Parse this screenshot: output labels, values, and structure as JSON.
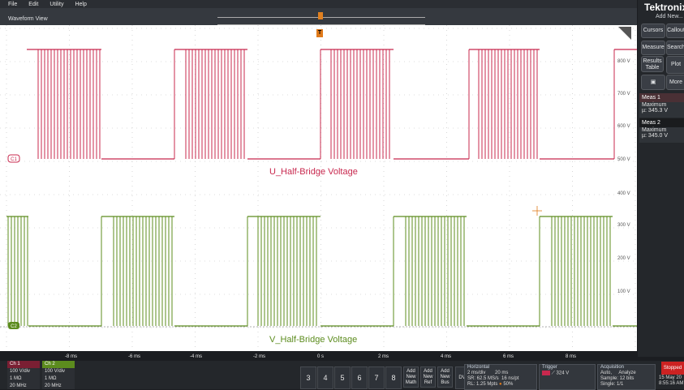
{
  "menu": {
    "items": [
      "File",
      "Edit",
      "Utility",
      "Help"
    ]
  },
  "waveform": {
    "title": "Waveform View",
    "trigger_marker": "T",
    "ch1_label": "U_Half-Bridge Voltage",
    "ch2_label": "V_Half-Bridge Voltage",
    "ch1_tag": "C1",
    "ch2_tag": "C2",
    "y_labels": [
      "800 V",
      "700 V",
      "600 V",
      "500 V",
      "400 V",
      "300 V",
      "200 V",
      "100 V"
    ],
    "x_labels": [
      "-8 ms",
      "-6 ms",
      "-4 ms",
      "-2 ms",
      "0 s",
      "2 ms",
      "4 ms",
      "6 ms",
      "8 ms"
    ],
    "colors": {
      "ch1": "#c8284e",
      "ch2": "#5c8c1e",
      "accent": "#e07a1a"
    }
  },
  "right_panel": {
    "brand": "Tektronix",
    "add_new": "Add New...",
    "buttons": [
      "Cursors",
      "Callout",
      "Measure",
      "Search",
      "Results Table",
      "Plot",
      "More"
    ],
    "meas": [
      {
        "title": "Meas 1",
        "name": "Maximum",
        "value": "µ: 345.3 V"
      },
      {
        "title": "Meas 2",
        "name": "Maximum",
        "value": "µ: 345.0 V"
      }
    ]
  },
  "channels": [
    {
      "name": "Ch 1",
      "scale": "100 V/div",
      "impedance": "1 MΩ",
      "bw": "20 MHz",
      "color": "#7a1f33"
    },
    {
      "name": "Ch 2",
      "scale": "100 V/div",
      "impedance": "1 MΩ",
      "bw": "20 MHz",
      "color": "#5c8c1e"
    }
  ],
  "number_buttons": [
    "3",
    "4",
    "5",
    "6",
    "7",
    "8"
  ],
  "add_buttons": [
    {
      "l1": "Add",
      "l2": "New",
      "l3": "Math"
    },
    {
      "l1": "Add",
      "l2": "New",
      "l3": "Ref"
    },
    {
      "l1": "Add",
      "l2": "New",
      "l3": "Bus"
    }
  ],
  "dvm": "DVM",
  "horizontal": {
    "title": "Horizontal",
    "scale": "2 ms/div",
    "record": "20 ms",
    "sr": "SR: 62.5 MS/s",
    "pt": "16 ns/pt",
    "rl": "RL: 1.25 Mpts",
    "pos": "50%"
  },
  "trigger": {
    "title": "Trigger",
    "level": "324 V"
  },
  "acquisition": {
    "title": "Acquisition",
    "mode": "Auto,",
    "analyze": "Analyze",
    "sample": "Sample: 12 bits",
    "single": "Single: 1/1"
  },
  "status": {
    "state": "Stopped",
    "date": "15 May 20",
    "time": "8:55:16 AM"
  }
}
